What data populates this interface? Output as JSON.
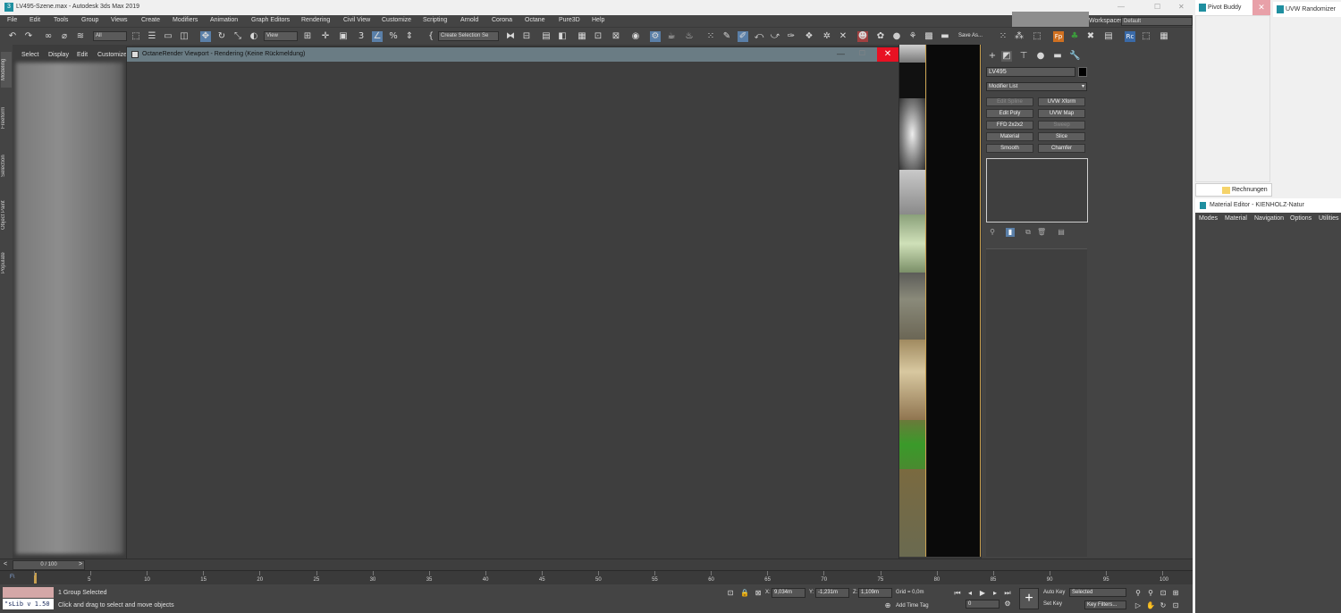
{
  "app": {
    "title": "LV495-Szene.max - Autodesk 3ds Max 2019"
  },
  "menu": [
    "File",
    "Edit",
    "Tools",
    "Group",
    "Views",
    "Create",
    "Modifiers",
    "Animation",
    "Graph Editors",
    "Rendering",
    "Civil View",
    "Customize",
    "Scripting",
    "Arnold",
    "Corona",
    "Octane",
    "Pure3D",
    "Help"
  ],
  "toolbar": {
    "filter": "All",
    "refcoord": "View",
    "selection_set": "Create Selection Se",
    "save_as": "Save As..."
  },
  "workspaces": {
    "label": "Workspaces:",
    "value": "Default"
  },
  "left_tabs": [
    "Modeling",
    "Freeform",
    "Selection",
    "Object Paint",
    "Populate"
  ],
  "scene_explorer": {
    "tabs": [
      "Select",
      "Display",
      "Edit",
      "Customize"
    ]
  },
  "octane": {
    "title": "OctaneRender Viewport - Rendering (Keine Rückmeldung)"
  },
  "command_panel": {
    "object_name": "LV495",
    "modifier_list": "Modifier List",
    "buttons": [
      {
        "label": "Edit Spline",
        "disabled": true
      },
      {
        "label": "UVW Xform",
        "disabled": false
      },
      {
        "label": "Edit Poly",
        "disabled": false
      },
      {
        "label": "UVW Map",
        "disabled": false
      },
      {
        "label": "FFD 2x2x2",
        "disabled": false
      },
      {
        "label": "Sweep",
        "disabled": true
      },
      {
        "label": "Material",
        "disabled": false
      },
      {
        "label": "Slice",
        "disabled": false
      },
      {
        "label": "Smooth",
        "disabled": false
      },
      {
        "label": "Chamfer",
        "disabled": false
      }
    ]
  },
  "time_slider": {
    "value": "0 / 100"
  },
  "trackbar": {
    "ticks": [
      "0",
      "5",
      "10",
      "15",
      "20",
      "25",
      "30",
      "35",
      "40",
      "45",
      "50",
      "55",
      "60",
      "65",
      "70",
      "75",
      "80",
      "85",
      "90",
      "95",
      "100"
    ]
  },
  "status": {
    "maxscript": "\"sLib v 1.50",
    "selection": "1 Group Selected",
    "prompt": "Click and drag to select and move objects",
    "x": "9,034m",
    "y": "-1,231m",
    "z": "1,109m",
    "grid": "Grid = 0,0m",
    "add_time_tag": "Add Time Tag",
    "auto_key": "Auto Key",
    "set_key": "Set Key",
    "key_mode": "Selected",
    "key_filters": "Key Filters...",
    "frame": "0"
  },
  "floating": {
    "pivot_buddy": "Pivot Buddy",
    "uvw_randomizer": "UVW Randomizer",
    "rechnungen": "Rechnungen",
    "material_editor": {
      "title": "Material Editor - KIENHOLZ-Natur",
      "menu": [
        "Modes",
        "Material",
        "Navigation",
        "Options",
        "Utilities"
      ]
    }
  },
  "colors": {
    "accent_close": "#e81123",
    "viewport_border": "#c8a050",
    "octane_title": "#6a7c84"
  }
}
